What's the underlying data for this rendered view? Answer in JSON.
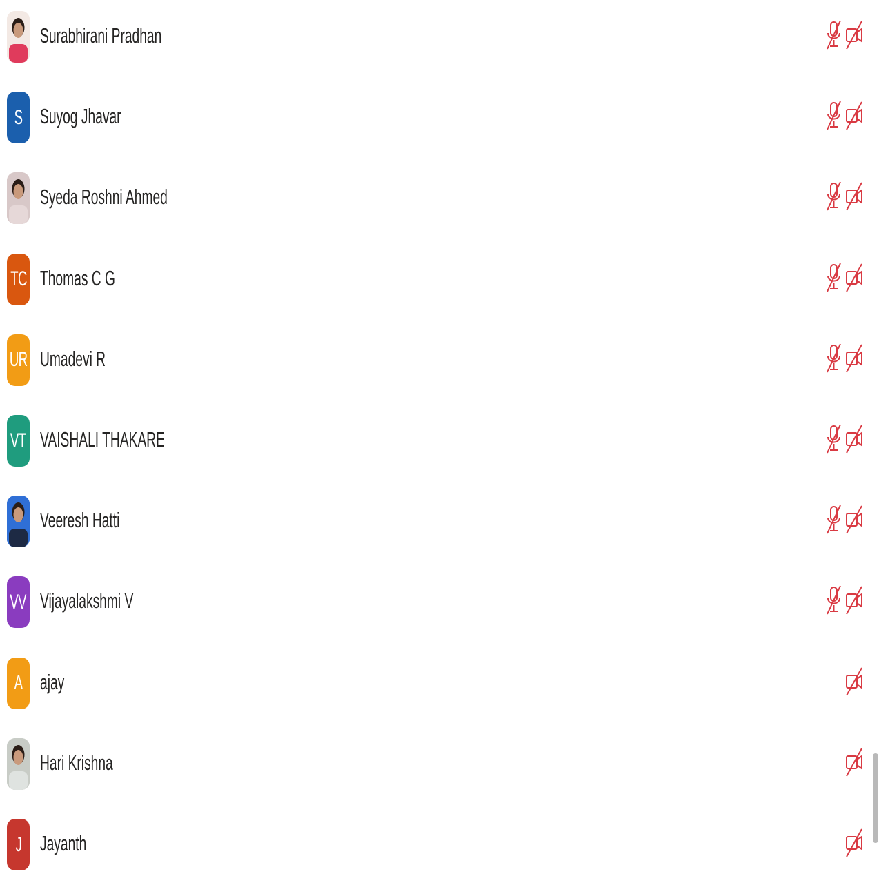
{
  "participants": [
    {
      "name": "Surabhirani Pradhan",
      "initials": "",
      "avatar_type": "photo",
      "avatar_icon": "person-photo-woman-red",
      "avatar_color": "#f3e9e4",
      "mic_off": true,
      "camera_off": true
    },
    {
      "name": "Suyog Jhavar",
      "initials": "S",
      "avatar_type": "initials",
      "avatar_color": "#1b5fad",
      "mic_off": true,
      "camera_off": true
    },
    {
      "name": "Syeda Roshni Ahmed",
      "initials": "",
      "avatar_type": "photo",
      "avatar_icon": "person-photo-woman-pale",
      "avatar_color": "#d8c8c8",
      "mic_off": true,
      "camera_off": true
    },
    {
      "name": "Thomas C G",
      "initials": "TC",
      "avatar_type": "initials",
      "avatar_color": "#d9570f",
      "mic_off": true,
      "camera_off": true
    },
    {
      "name": "Umadevi R",
      "initials": "UR",
      "avatar_type": "initials",
      "avatar_color": "#f29c15",
      "mic_off": true,
      "camera_off": true
    },
    {
      "name": "VAISHALI THAKARE",
      "initials": "VT",
      "avatar_type": "initials",
      "avatar_color": "#1f9c7e",
      "mic_off": true,
      "camera_off": true
    },
    {
      "name": "Veeresh Hatti",
      "initials": "",
      "avatar_type": "photo",
      "avatar_icon": "person-photo-man-blue",
      "avatar_color": "#2f6fd6",
      "mic_off": true,
      "camera_off": true
    },
    {
      "name": "Vijayalakshmi V",
      "initials": "VV",
      "avatar_type": "initials",
      "avatar_color": "#8a3cbf",
      "mic_off": true,
      "camera_off": true
    },
    {
      "name": "ajay",
      "initials": "A",
      "avatar_type": "initials",
      "avatar_color": "#f29c15",
      "mic_off": false,
      "camera_off": true
    },
    {
      "name": "Hari Krishna",
      "initials": "",
      "avatar_type": "photo",
      "avatar_icon": "person-photo-man-grey",
      "avatar_color": "#c8ccc6",
      "mic_off": false,
      "camera_off": true
    },
    {
      "name": "Jayanth",
      "initials": "J",
      "avatar_type": "initials",
      "avatar_color": "#c6372e",
      "mic_off": false,
      "camera_off": true
    }
  ],
  "icons": {
    "mic_off": "mic-off-icon",
    "camera_off": "camera-off-icon"
  },
  "colors": {
    "status_red": "#d93a43",
    "name_text": "#252423"
  },
  "scroll_position": 0.88
}
